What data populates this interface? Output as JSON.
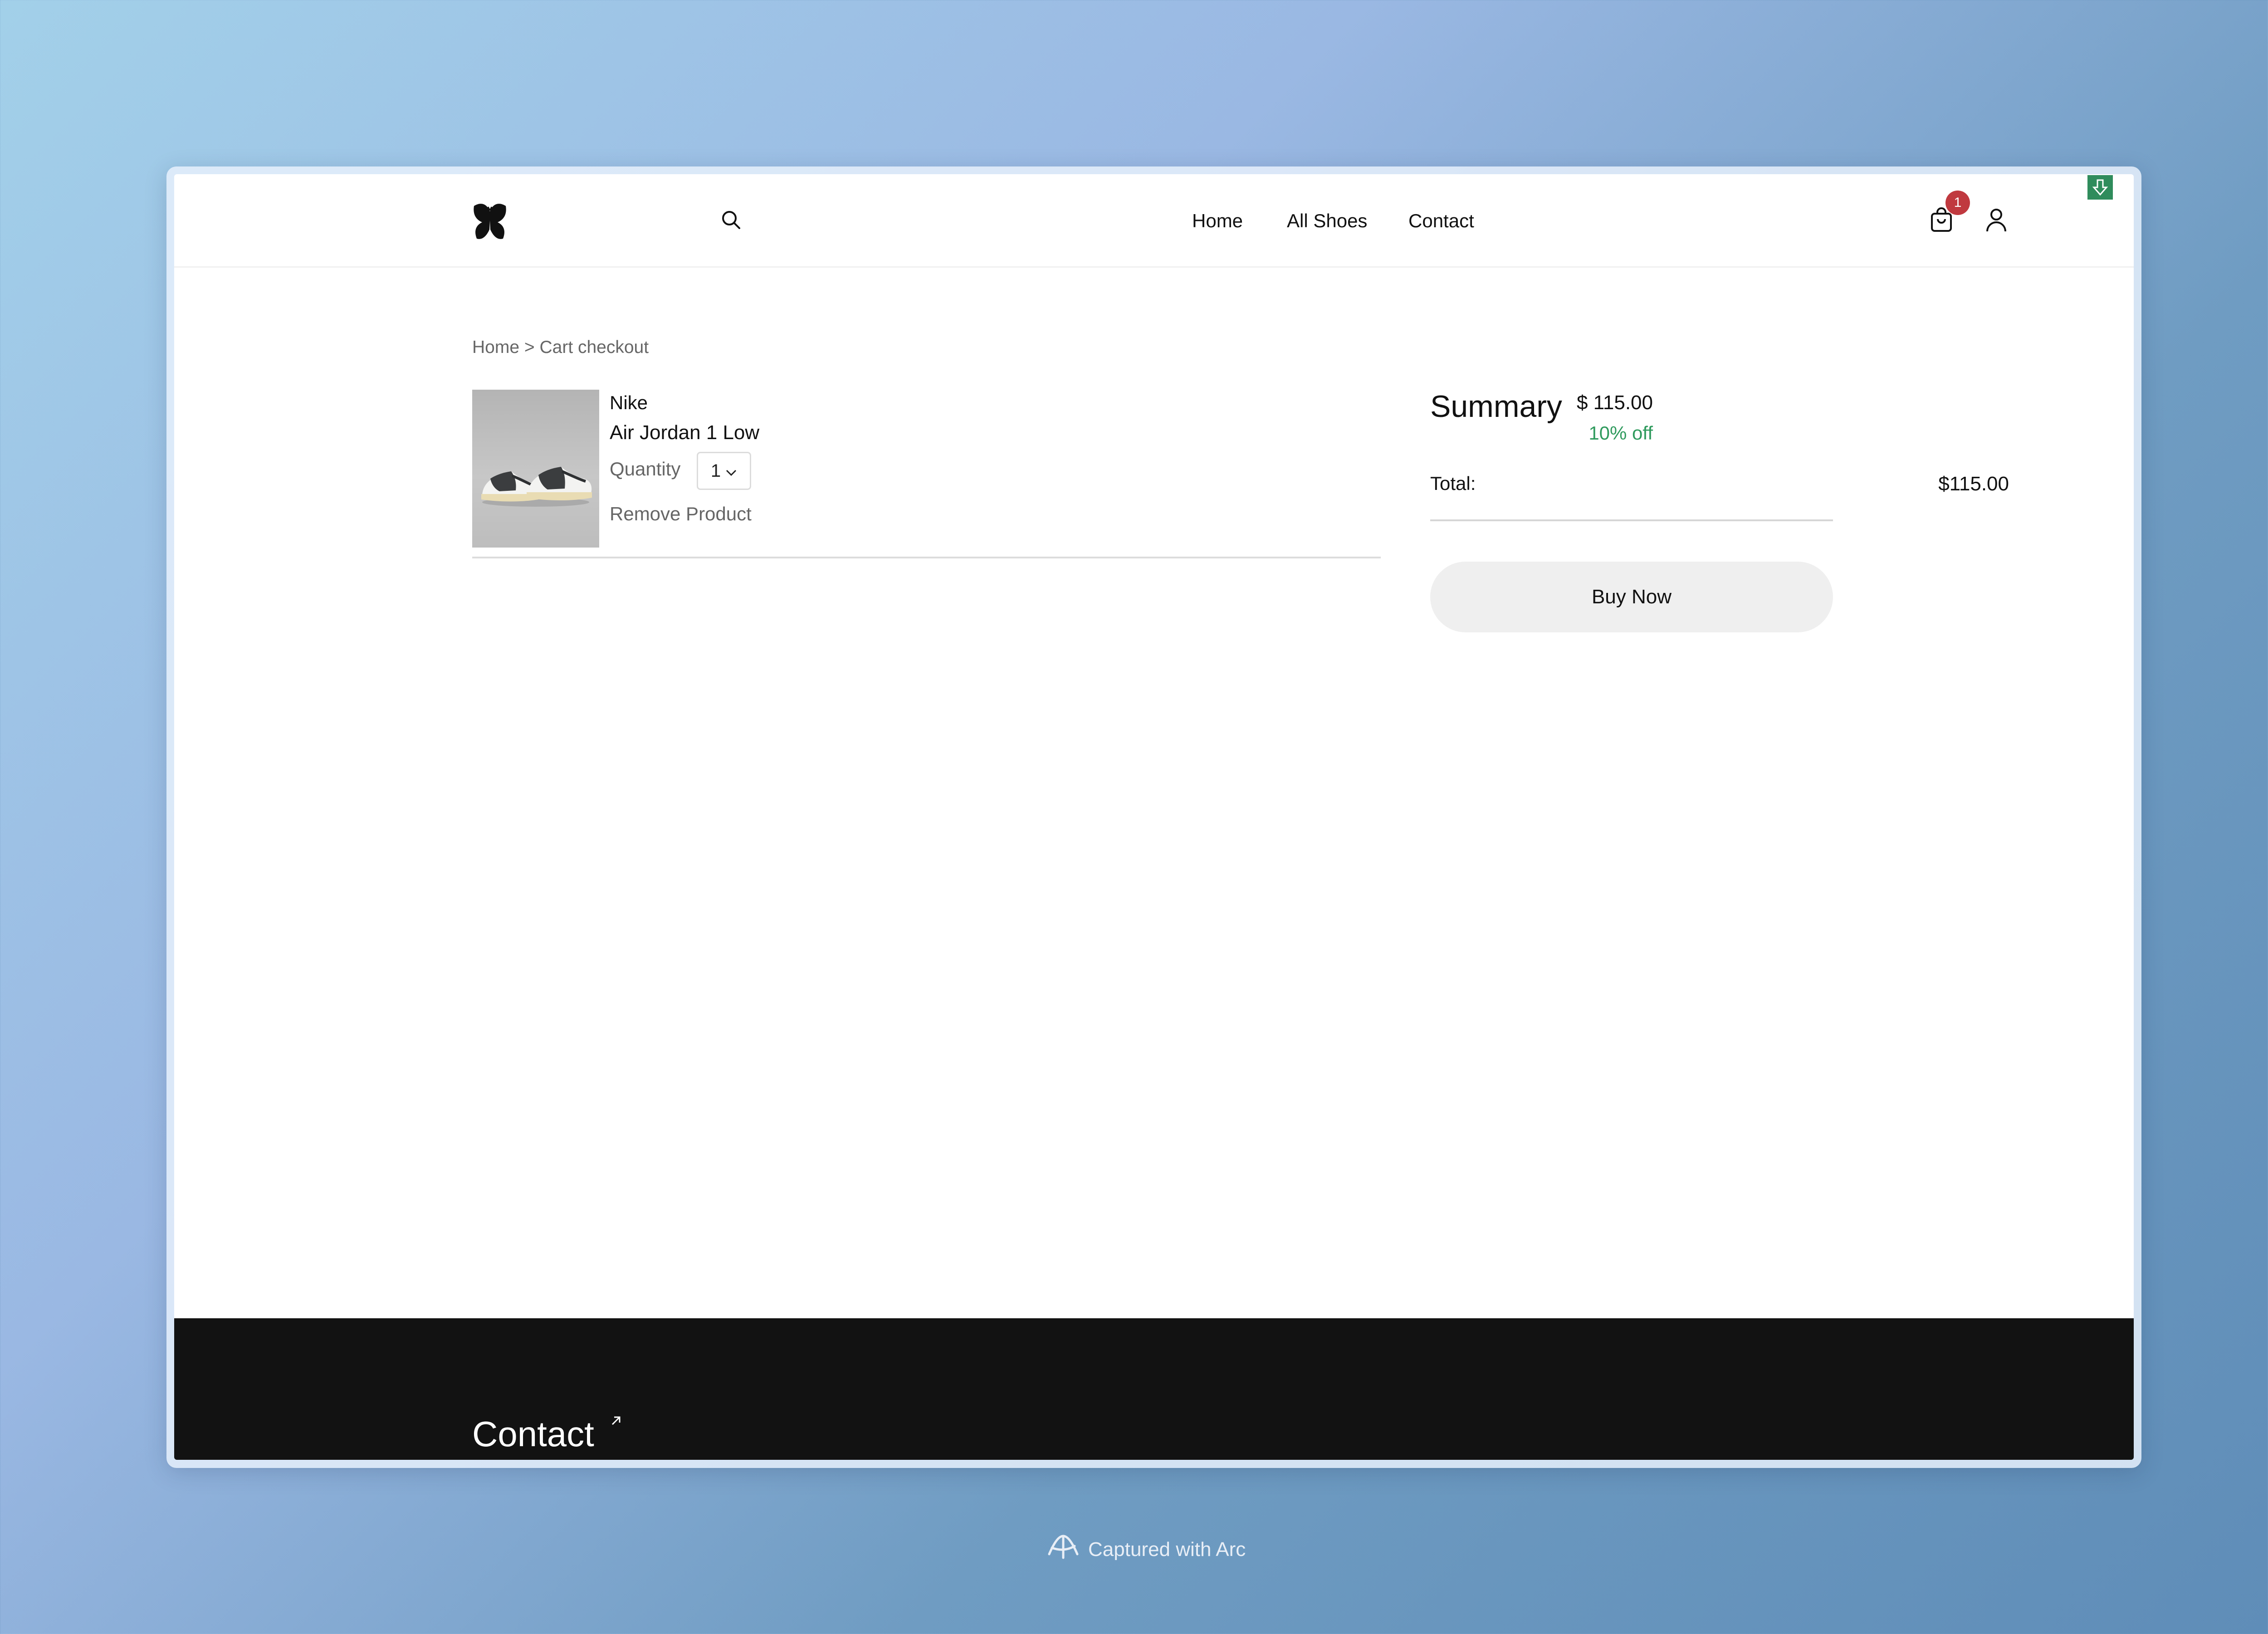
{
  "header": {
    "logo_icon": "butterfly-logo-icon",
    "search_icon": "search-icon",
    "nav": [
      {
        "label": "Home"
      },
      {
        "label": "All Shoes"
      },
      {
        "label": "Contact"
      }
    ],
    "cart_icon": "shopping-bag-icon",
    "cart_count": "1",
    "user_icon": "user-icon",
    "extension_icon": "download-arrow-icon"
  },
  "breadcrumb": "Home > Cart checkout",
  "cart_item": {
    "image_icon": "sneaker-product-image",
    "brand": "Nike",
    "name": "Air Jordan 1 Low",
    "quantity_label": "Quantity",
    "quantity_value": "1",
    "remove_label": "Remove Product",
    "price": "$ 115.00",
    "discount": "10% off"
  },
  "summary": {
    "title": "Summary",
    "total_label": "Total:",
    "total_value": "$115.00",
    "buy_label": "Buy Now"
  },
  "footer": {
    "contact_label": "Contact"
  },
  "capture": {
    "text": "Captured with Arc"
  },
  "colors": {
    "badge": "#c0393f",
    "discount": "#2f9a5d",
    "footer_bg": "#121212",
    "extension": "#2f8c5c"
  }
}
